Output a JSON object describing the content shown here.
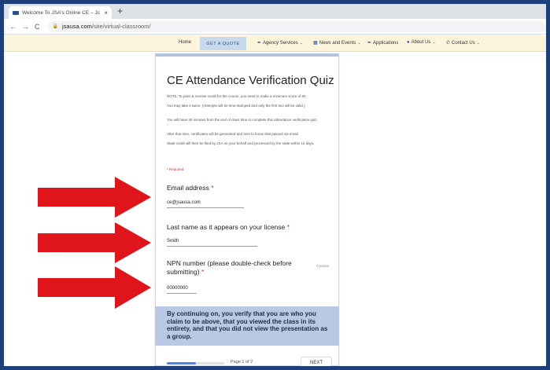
{
  "browser": {
    "tab_title": "Welcome To JSA's Online CE – Jc",
    "tab_close": "×",
    "new_tab": "+",
    "url_host": "jsausa.com",
    "url_path": "/site/virtual-classroom/"
  },
  "site_nav": {
    "home": "Home",
    "get_quote": "GET A QUOTE",
    "agency_services": "Agency Services",
    "news_events": "News and Events",
    "applications": "Applications",
    "about_us": "About Us",
    "contact_us": "Contact Us"
  },
  "form": {
    "title": "CE Attendance Verification Quiz",
    "paragraphs": [
      "NOTE: To pass & receive credit for the course, you need to make a minimum score of 80.",
      "You may take it twice. (Attempts will be time-stamped and only the first two will be valid.)",
      "You will have 30 minutes from the end of class time to complete this attendance verification quiz.",
      "After that time, certificates will be generated and sent to those that passed via email.",
      "State credit will then be filed by JSA on your behalf and processed by the state within 14 days."
    ],
    "required_note": "* Required",
    "questions": [
      {
        "label": "Email address",
        "required": "*",
        "value": "ce@jsausa.com"
      },
      {
        "label": "Last name as it appears on your license",
        "required": "*",
        "value": "Smith"
      },
      {
        "label": "NPN number (please double-check before submitting)",
        "required": "*",
        "value": "00000000",
        "points": "0 points"
      }
    ],
    "banner": "By continuing on, you verify that you are who you claim to be above, that you viewed the class in its entirety, and that you did not view the presentation as a group.",
    "progress_fraction": 0.5,
    "page_label": "Page 1 of 2",
    "next_label": "NEXT"
  },
  "colors": {
    "frame": "#1d3f7a",
    "nav_bg": "#fdf4dc",
    "banner": "#b9c9e4",
    "arrow": "#e0141b",
    "required": "#d93025"
  }
}
